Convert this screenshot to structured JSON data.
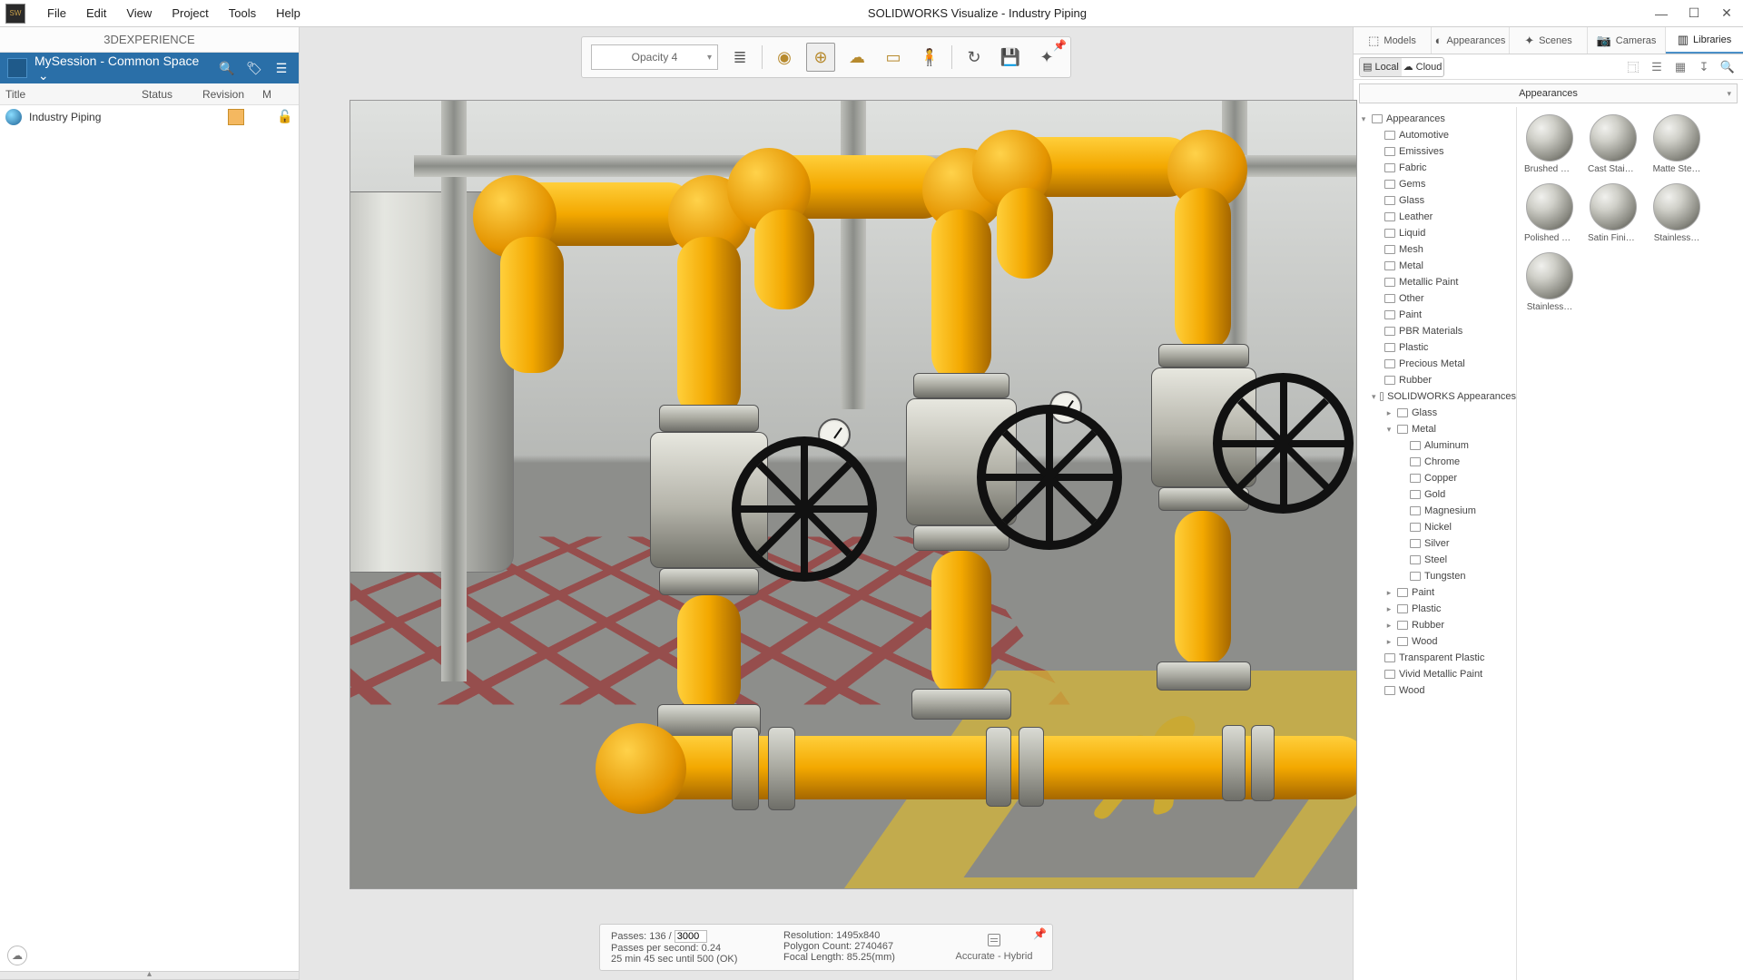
{
  "app": {
    "title": "SOLIDWORKS Visualize - Industry Piping"
  },
  "menu": [
    "File",
    "Edit",
    "View",
    "Project",
    "Tools",
    "Help"
  ],
  "left": {
    "header": "3DEXPERIENCE",
    "session": "MySession - Common Space",
    "cols": {
      "title": "Title",
      "status": "Status",
      "revision": "Revision",
      "m": "M"
    },
    "row": {
      "title": "Industry Piping"
    }
  },
  "toolbar": {
    "opacity": "Opacity 4"
  },
  "status": {
    "passes_label": "Passes:",
    "passes_cur": "136",
    "passes_sep": "/",
    "passes_max": "3000",
    "pps": "Passes per second: 0.24",
    "eta": "25 min 45 sec until 500 (OK)",
    "resolution": "Resolution: 1495x840",
    "polycount": "Polygon Count: 2740467",
    "focal": "Focal Length: 85.25(mm)",
    "accuracy": "Accurate - Hybrid"
  },
  "right": {
    "tabs": [
      "Models",
      "Appearances",
      "Scenes",
      "Cameras",
      "Libraries"
    ],
    "seg": {
      "local": "Local",
      "cloud": "Cloud"
    },
    "apphdr": "Appearances",
    "tree": [
      {
        "d": 0,
        "tw": "▾",
        "label": "Appearances"
      },
      {
        "d": 1,
        "label": "Automotive"
      },
      {
        "d": 1,
        "label": "Emissives"
      },
      {
        "d": 1,
        "label": "Fabric"
      },
      {
        "d": 1,
        "label": "Gems"
      },
      {
        "d": 1,
        "label": "Glass"
      },
      {
        "d": 1,
        "label": "Leather"
      },
      {
        "d": 1,
        "label": "Liquid"
      },
      {
        "d": 1,
        "label": "Mesh"
      },
      {
        "d": 1,
        "label": "Metal"
      },
      {
        "d": 1,
        "label": "Metallic Paint"
      },
      {
        "d": 1,
        "label": "Other"
      },
      {
        "d": 1,
        "label": "Paint"
      },
      {
        "d": 1,
        "label": "PBR Materials"
      },
      {
        "d": 1,
        "label": "Plastic"
      },
      {
        "d": 1,
        "label": "Precious Metal"
      },
      {
        "d": 1,
        "label": "Rubber"
      },
      {
        "d": 1,
        "tw": "▾",
        "label": "SOLIDWORKS Appearances"
      },
      {
        "d": 2,
        "tw": "▸",
        "label": "Glass"
      },
      {
        "d": 2,
        "tw": "▾",
        "label": "Metal"
      },
      {
        "d": 3,
        "label": "Aluminum"
      },
      {
        "d": 3,
        "label": "Chrome"
      },
      {
        "d": 3,
        "label": "Copper"
      },
      {
        "d": 3,
        "label": "Gold"
      },
      {
        "d": 3,
        "label": "Magnesium"
      },
      {
        "d": 3,
        "label": "Nickel"
      },
      {
        "d": 3,
        "label": "Silver"
      },
      {
        "d": 3,
        "label": "Steel"
      },
      {
        "d": 3,
        "label": "Tungsten"
      },
      {
        "d": 2,
        "tw": "▸",
        "label": "Paint"
      },
      {
        "d": 2,
        "tw": "▸",
        "label": "Plastic"
      },
      {
        "d": 2,
        "tw": "▸",
        "label": "Rubber"
      },
      {
        "d": 2,
        "tw": "▸",
        "label": "Wood"
      },
      {
        "d": 1,
        "label": "Transparent Plastic"
      },
      {
        "d": 1,
        "label": "Vivid Metallic Paint"
      },
      {
        "d": 1,
        "label": "Wood"
      }
    ],
    "thumbs": [
      "Brushed S…",
      "Cast Stain…",
      "Matte Ste…",
      "Polished S…",
      "Satin Finis…",
      "Stainless…",
      "Stainless…"
    ]
  }
}
